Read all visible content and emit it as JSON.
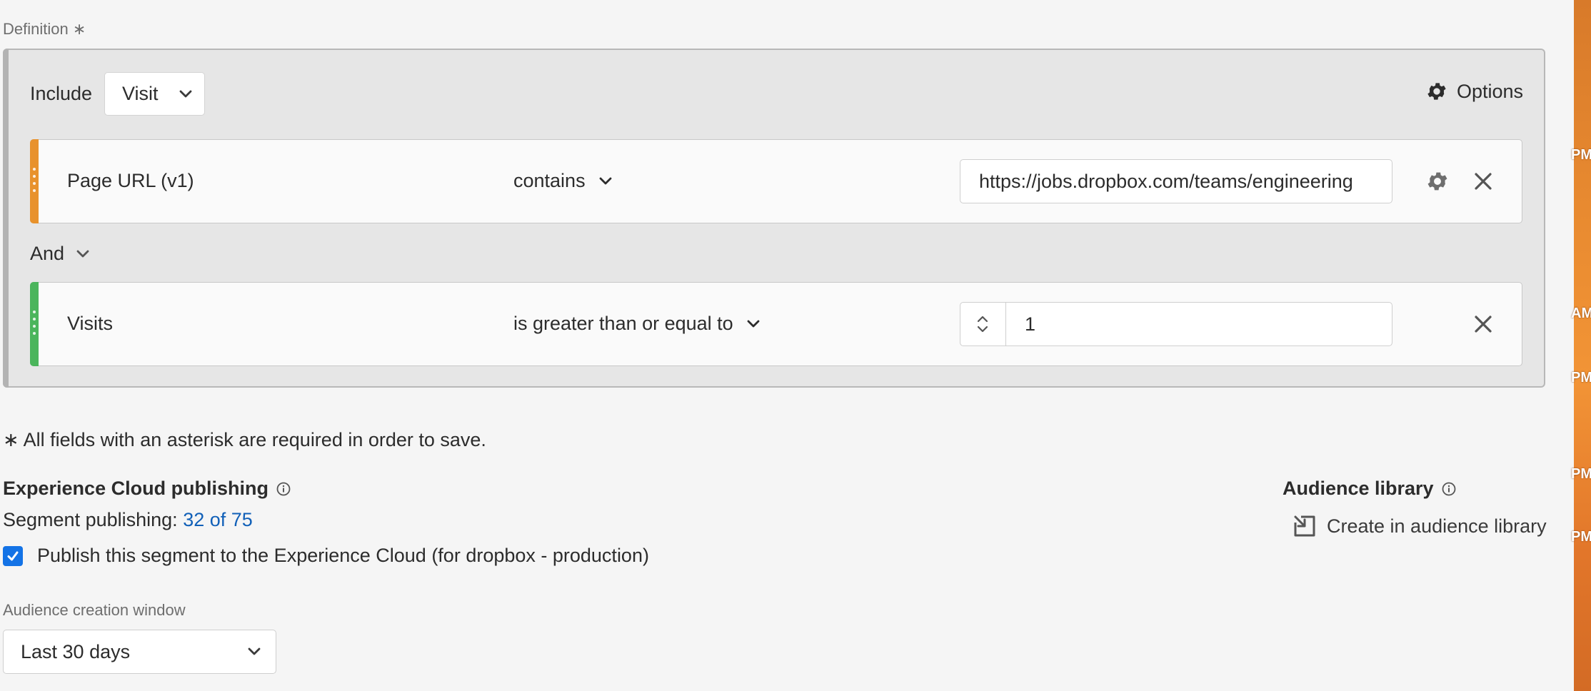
{
  "definition": {
    "label": "Definition ∗"
  },
  "container": {
    "include_label": "Include",
    "scope": "Visit",
    "options_label": "Options"
  },
  "rules": [
    {
      "name": "Page URL (v1)",
      "operator": "contains",
      "value": "https://jobs.dropbox.com/teams/engineering",
      "accent_color": "#e8922c"
    },
    {
      "name": "Visits",
      "operator": "is greater than or equal to",
      "value": "1",
      "accent_color": "#4bb55c"
    }
  ],
  "conjunction": "And",
  "required_note": "∗ All fields with an asterisk are required in order to save.",
  "experience_cloud": {
    "title": "Experience Cloud publishing",
    "segment_publishing_label": "Segment publishing:",
    "segment_publishing_value": "32 of 75",
    "publish_checkbox_label": "Publish this segment to the Experience Cloud (for dropbox - production)",
    "publish_checked": true
  },
  "audience_window": {
    "label": "Audience creation window",
    "selected": "Last 30 days"
  },
  "audience_library": {
    "title": "Audience library",
    "create_link": "Create in audience library"
  },
  "right_strip": [
    "PM",
    "AM",
    "PM",
    "PM",
    "PM"
  ],
  "colors": {
    "accent_blue": "#1473e6",
    "link_blue": "#1160b8"
  }
}
